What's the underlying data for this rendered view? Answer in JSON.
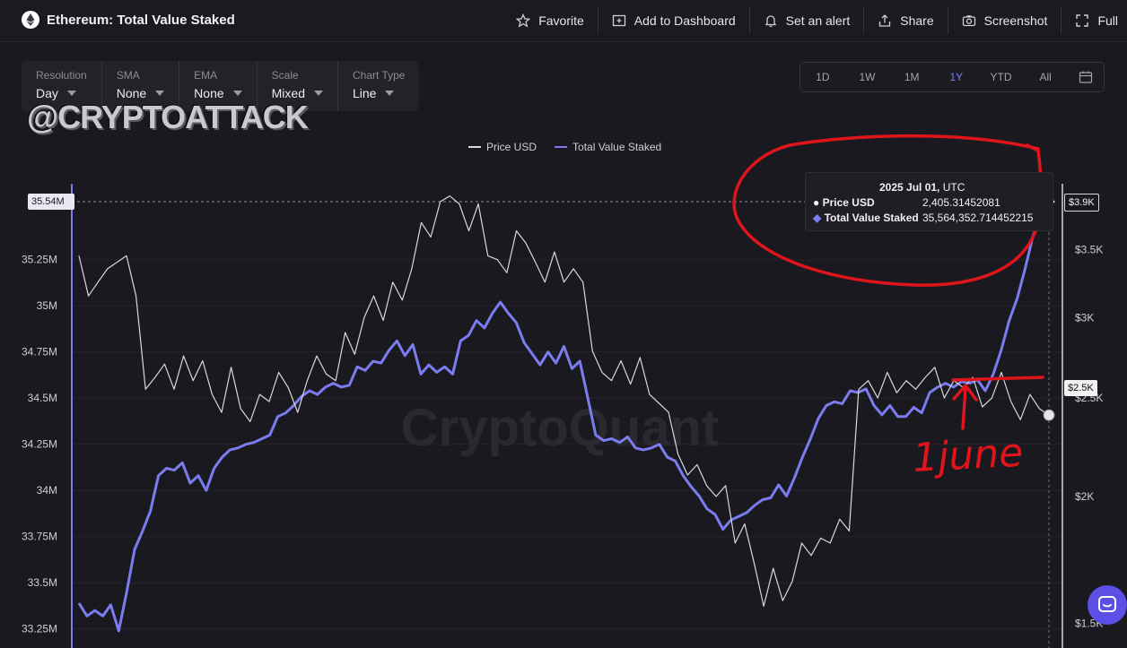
{
  "header": {
    "title": "Ethereum: Total Value Staked",
    "actions": [
      {
        "label": "Favorite",
        "icon": "star-icon"
      },
      {
        "label": "Add to Dashboard",
        "icon": "dashboard-icon"
      },
      {
        "label": "Set an alert",
        "icon": "bell-icon"
      },
      {
        "label": "Share",
        "icon": "share-icon"
      },
      {
        "label": "Screenshot",
        "icon": "camera-icon"
      },
      {
        "label": "Full",
        "icon": "fullscreen-icon"
      }
    ]
  },
  "toolbar": {
    "resolution": {
      "label": "Resolution",
      "value": "Day"
    },
    "sma": {
      "label": "SMA",
      "value": "None"
    },
    "ema": {
      "label": "EMA",
      "value": "None"
    },
    "scale": {
      "label": "Scale",
      "value": "Mixed"
    },
    "chart_type": {
      "label": "Chart Type",
      "value": "Line"
    }
  },
  "range": {
    "options": [
      "1D",
      "1W",
      "1M",
      "1Y",
      "YTD",
      "All"
    ],
    "active": "1Y"
  },
  "overlay": {
    "handle": "@CRYPTOATTACK",
    "annotation": "1june"
  },
  "watermark": "CryptoQuant",
  "tooltip": {
    "date": "2025 Jul 01,",
    "tz": "UTC",
    "price_label": "Price USD",
    "price_value": "2,405.31452081",
    "tvs_label": "Total Value Staked",
    "tvs_value": "35,564,352.714452215"
  },
  "badges": {
    "left": "35.54M",
    "right_top": "$3.9K",
    "right_mid": "$2.5K"
  },
  "colors": {
    "price": "#d8d8dc",
    "tvs": "#7b7cf0",
    "annotation": "#e0151c",
    "accent": "#5b4fe6"
  },
  "chart_data": {
    "type": "line",
    "title": "",
    "legend": [
      "Price USD",
      "Total Value Staked"
    ],
    "legend_position": "top-center",
    "left_axis": {
      "ticks": [
        "33.25M",
        "33.5M",
        "33.75M",
        "34M",
        "34.25M",
        "34.5M",
        "34.75M",
        "35M",
        "35.25M"
      ],
      "range": [
        33.22,
        35.62
      ]
    },
    "right_axis": {
      "ticks": [
        "$1.5K",
        "$2K",
        "$2.5K",
        "$3K",
        "$3.5K"
      ],
      "scale": "log",
      "range": [
        1450,
        4150
      ]
    },
    "x_range": [
      "2024 Jul 01",
      "2025 Jul 01"
    ],
    "grid": true,
    "series": [
      {
        "name": "Total Value Staked",
        "axis": "left",
        "values": [
          33.39,
          33.32,
          33.35,
          33.32,
          33.38,
          33.24,
          33.45,
          33.68,
          33.78,
          33.89,
          34.08,
          34.12,
          34.11,
          34.15,
          34.04,
          34.08,
          34.0,
          34.12,
          34.18,
          34.22,
          34.23,
          34.25,
          34.26,
          34.28,
          34.3,
          34.4,
          34.42,
          34.46,
          34.51,
          34.54,
          34.52,
          34.56,
          34.58,
          34.56,
          34.57,
          34.67,
          34.65,
          34.7,
          34.69,
          34.76,
          34.81,
          34.73,
          34.79,
          34.63,
          34.68,
          34.64,
          34.67,
          34.63,
          34.81,
          34.84,
          34.92,
          34.88,
          34.96,
          35.02,
          34.96,
          34.91,
          34.8,
          34.74,
          34.68,
          34.75,
          34.69,
          34.78,
          34.66,
          34.7,
          34.5,
          34.3,
          34.27,
          34.28,
          34.26,
          34.29,
          34.23,
          34.22,
          34.23,
          34.25,
          34.18,
          34.16,
          34.08,
          34.02,
          33.97,
          33.9,
          33.87,
          33.79,
          33.84,
          33.86,
          33.88,
          33.92,
          33.95,
          33.96,
          34.03,
          33.97,
          34.07,
          34.18,
          34.28,
          34.39,
          34.46,
          34.48,
          34.47,
          34.54,
          34.53,
          34.55,
          34.46,
          34.41,
          34.46,
          34.4,
          34.4,
          34.45,
          34.42,
          34.53,
          34.56,
          34.58,
          34.56,
          34.59,
          34.58,
          34.6,
          34.54,
          34.63,
          34.76,
          34.92,
          35.04,
          35.2,
          35.38,
          35.48,
          35.5642
        ]
      },
      {
        "name": "Price USD",
        "axis": "right",
        "values": [
          3450,
          3150,
          3250,
          3350,
          3400,
          3450,
          3150,
          2550,
          2620,
          2700,
          2550,
          2750,
          2600,
          2720,
          2520,
          2420,
          2680,
          2440,
          2370,
          2520,
          2480,
          2650,
          2560,
          2420,
          2600,
          2750,
          2640,
          2600,
          2900,
          2760,
          3000,
          3150,
          2980,
          3250,
          3120,
          3350,
          3720,
          3600,
          3900,
          3950,
          3880,
          3650,
          3880,
          3450,
          3420,
          3320,
          3650,
          3550,
          3400,
          3250,
          3480,
          3250,
          3350,
          3250,
          2780,
          2650,
          2600,
          2720,
          2580,
          2740,
          2520,
          2470,
          2420,
          2200,
          2100,
          2150,
          2050,
          2000,
          2050,
          1800,
          1880,
          1720,
          1560,
          1700,
          1580,
          1650,
          1800,
          1750,
          1820,
          1800,
          1900,
          1850,
          2550,
          2600,
          2500,
          2650,
          2530,
          2600,
          2550,
          2620,
          2680,
          2500,
          2600,
          2560,
          2620,
          2450,
          2500,
          2650,
          2480,
          2380,
          2520,
          2440,
          2405
        ]
      }
    ]
  }
}
